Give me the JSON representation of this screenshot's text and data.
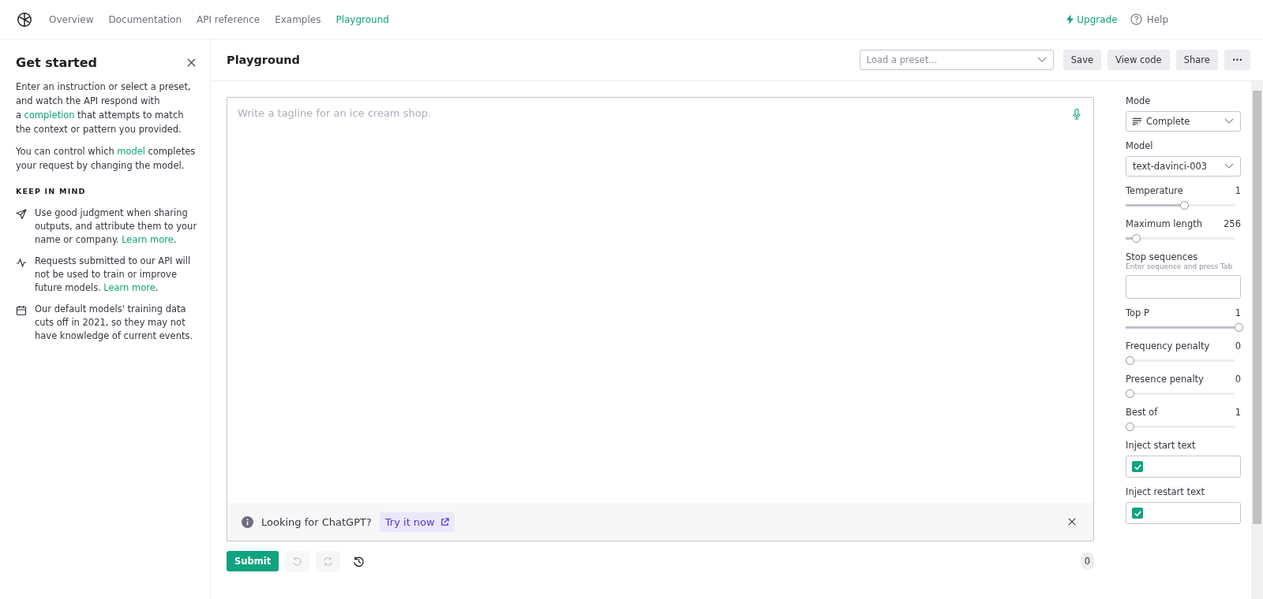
{
  "nav": {
    "items": [
      {
        "label": "Overview",
        "selected": false
      },
      {
        "label": "Documentation",
        "selected": false
      },
      {
        "label": "API reference",
        "selected": false
      },
      {
        "label": "Examples",
        "selected": false
      },
      {
        "label": "Playground",
        "selected": true
      }
    ],
    "upgrade": "Upgrade",
    "help": "Help"
  },
  "sidebar": {
    "title": "Get started",
    "paragraphs": [
      {
        "before": "Enter an instruction or select a preset, and watch the API respond with a",
        "link": "completion",
        "after": "that attempts to match the context or pattern you provided."
      },
      {
        "before": "You can control which",
        "link": "model",
        "after": "completes your request by changing the model."
      }
    ],
    "section_title": "KEEP IN MIND",
    "notes": [
      {
        "kind": "send",
        "text": "Use good judgment when sharing outputs, and attribute them to your name or company.",
        "link": "Learn more",
        "after": "."
      },
      {
        "kind": "activity",
        "text": "Requests submitted to our API will not be used to train or improve future models.",
        "link": "Learn more",
        "after": "."
      },
      {
        "kind": "calendar",
        "text": "Our default models' training data cuts off in 2021, so they may not have knowledge of current events."
      }
    ]
  },
  "header": {
    "title": "Playground",
    "preset_placeholder": "Load a preset...",
    "buttons": [
      "Save",
      "View code",
      "Share"
    ],
    "more": "···"
  },
  "editor": {
    "placeholder": "Write a tagline for an ice cream shop.",
    "banner": {
      "text": "Looking for ChatGPT?",
      "link": "Try it now"
    }
  },
  "footer": {
    "submit": "Submit",
    "token_count": "0"
  },
  "settings": [
    {
      "kind": "select",
      "label": "Mode",
      "value": "Complete",
      "icon": true
    },
    {
      "kind": "select",
      "label": "Model",
      "value": "text-davinci-003"
    },
    {
      "kind": "slider",
      "label": "Temperature",
      "value": "1",
      "level": 0.5
    },
    {
      "kind": "slider",
      "label": "Maximum length",
      "value": "256",
      "level": 0.06
    },
    {
      "kind": "text",
      "label": "Stop sequences",
      "hint": "Enter sequence and press Tab"
    },
    {
      "kind": "slider",
      "label": "Top P",
      "value": "1",
      "level": 1
    },
    {
      "kind": "slider",
      "label": "Frequency penalty",
      "value": "0",
      "level": 0
    },
    {
      "kind": "slider",
      "label": "Presence penalty",
      "value": "0",
      "level": 0
    },
    {
      "kind": "slider",
      "label": "Best of",
      "value": "1",
      "level": 0
    },
    {
      "kind": "check",
      "label": "Inject start text",
      "checked": true
    },
    {
      "kind": "check",
      "label": "Inject restart text",
      "checked": true
    }
  ]
}
